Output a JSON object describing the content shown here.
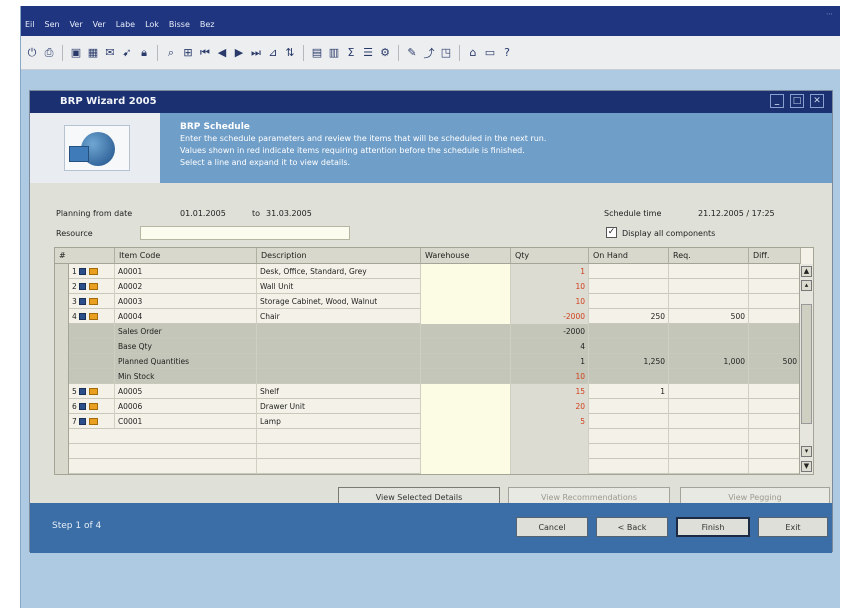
{
  "menu": [
    "Eil",
    "Sen",
    "Ver",
    "Ver",
    "Labe",
    "Lok",
    "Bisse",
    "Bez"
  ],
  "window": {
    "title": "BRP Wizard  2005"
  },
  "banner": {
    "heading": "BRP Schedule",
    "lines": [
      "Enter the schedule parameters and review the items that will be scheduled in the next run.",
      "Values shown in red indicate items requiring attention before the schedule is finished.",
      "Select a line and expand it to view details."
    ]
  },
  "fields": {
    "range_label": "Planning from date",
    "range_from": "01.01.2005",
    "range_sep": "to",
    "range_to": "31.03.2005",
    "schedule_label": "Schedule time",
    "schedule_value": "21.12.2005 / 17:25",
    "filter_label": "Resource",
    "filter_value": "",
    "checkbox_label": "Display all components",
    "checkbox_checked": true
  },
  "grid": {
    "columns": [
      "#",
      "Item Code",
      "Description",
      "Warehouse",
      "Qty",
      "On Hand",
      "Req.",
      "Diff."
    ],
    "rows": [
      {
        "n": "1",
        "code": "A0001",
        "desc": "Desk, Office, Standard, Grey",
        "qty": "1",
        "qty_red": true,
        "onhand": "",
        "req": "",
        "diff": "",
        "kind": "item"
      },
      {
        "n": "2",
        "code": "A0002",
        "desc": "Wall Unit",
        "qty": "10",
        "qty_red": true,
        "onhand": "",
        "req": "",
        "diff": "",
        "kind": "item"
      },
      {
        "n": "3",
        "code": "A0003",
        "desc": "Storage Cabinet, Wood, Walnut",
        "qty": "10",
        "qty_red": true,
        "onhand": "",
        "req": "",
        "diff": "",
        "kind": "item"
      },
      {
        "n": "4",
        "code": "A0004",
        "desc": "Chair",
        "qty": "-2000",
        "qty_red": true,
        "onhand": "250",
        "req": "500",
        "diff": "",
        "kind": "item"
      },
      {
        "n": "",
        "code": "Sales Order",
        "desc": "",
        "qty": "-2000",
        "qty_red": false,
        "onhand": "",
        "req": "",
        "diff": "",
        "kind": "sub"
      },
      {
        "n": "",
        "code": "Base Qty",
        "desc": "",
        "qty": "4",
        "qty_red": false,
        "onhand": "",
        "req": "",
        "diff": "",
        "kind": "sub"
      },
      {
        "n": "",
        "code": "Planned Quantities",
        "desc": "",
        "qty": "1",
        "qty_red": false,
        "onhand": "1,250",
        "req": "1,000",
        "diff": "500",
        "kind": "sub"
      },
      {
        "n": "",
        "code": "Min Stock",
        "desc": "",
        "qty": "10",
        "qty_red": true,
        "onhand": "",
        "req": "",
        "diff": "",
        "kind": "sub"
      },
      {
        "n": "5",
        "code": "A0005",
        "desc": "Shelf",
        "qty": "15",
        "qty_red": true,
        "onhand": "1",
        "req": "",
        "diff": "",
        "kind": "item"
      },
      {
        "n": "6",
        "code": "A0006",
        "desc": "Drawer Unit",
        "qty": "20",
        "qty_red": true,
        "onhand": "",
        "req": "",
        "diff": "",
        "kind": "item"
      },
      {
        "n": "7",
        "code": "C0001",
        "desc": "Lamp",
        "qty": "5",
        "qty_red": true,
        "onhand": "",
        "req": "",
        "diff": "",
        "kind": "item"
      }
    ]
  },
  "buttons": {
    "b1": "View Selected Details",
    "b2": "View Recommendations",
    "b3": "View Pegging"
  },
  "footer": {
    "status": "Step 1 of 4",
    "back": "Cancel",
    "prev": "< Back",
    "next": "Finish",
    "cancel": "Exit"
  }
}
